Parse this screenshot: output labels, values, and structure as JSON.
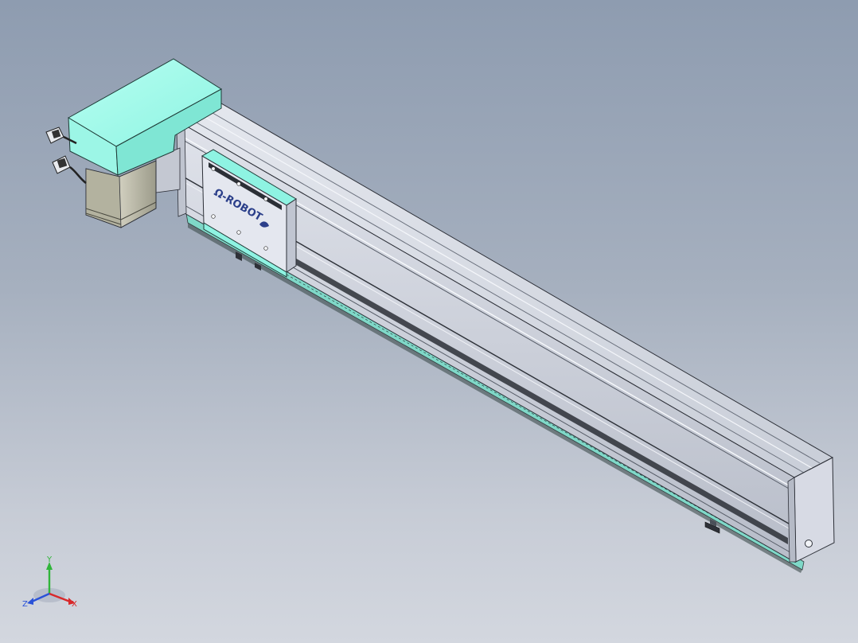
{
  "carriage": {
    "logo_text": "Ω-ROBOT"
  },
  "triad": {
    "x_label": "X",
    "y_label": "Y",
    "z_label": "Z"
  },
  "colors": {
    "background_top": "#8e9cb0",
    "background_bottom": "#d3d7df",
    "teal_accent": "#8ef3e2",
    "aluminium": "#c7cbd6",
    "motor_body": "#b9b8a6",
    "axis_x": "#d8282a",
    "axis_y": "#30b53a",
    "axis_z": "#2a52d8"
  },
  "icons": [
    "motor-cable-connector-icon",
    "triad-icon"
  ]
}
